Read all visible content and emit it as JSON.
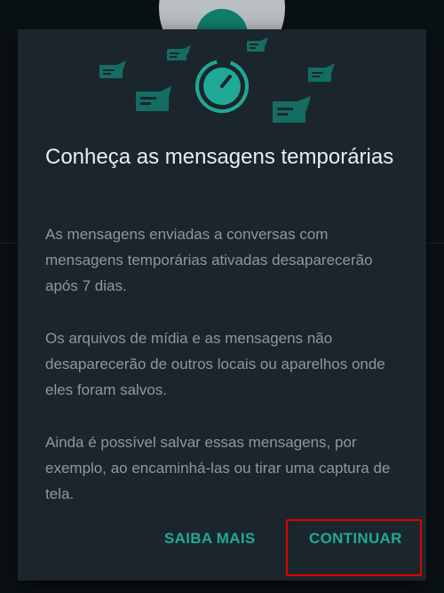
{
  "dialog": {
    "title": "Conheça as mensagens temporárias",
    "paragraphs": [
      "As mensagens enviadas a conversas com mensagens temporárias ativadas desaparecerão após 7 dias.",
      "Os arquivos de mídia e as mensagens não desaparecerão de outros locais ou aparelhos onde eles foram salvos.",
      "Ainda é possível salvar essas mensagens, por exemplo, ao encaminhá-las ou tirar uma captura de tela."
    ],
    "actions": {
      "learn_more": "SAIBA MAIS",
      "continue": "CONTINUAR"
    }
  },
  "colors": {
    "accent": "#1fa996",
    "dialog_background": "#1b262c",
    "highlight": "#e00000"
  },
  "icons": [
    "timer-icon",
    "message-bubble-icon"
  ]
}
